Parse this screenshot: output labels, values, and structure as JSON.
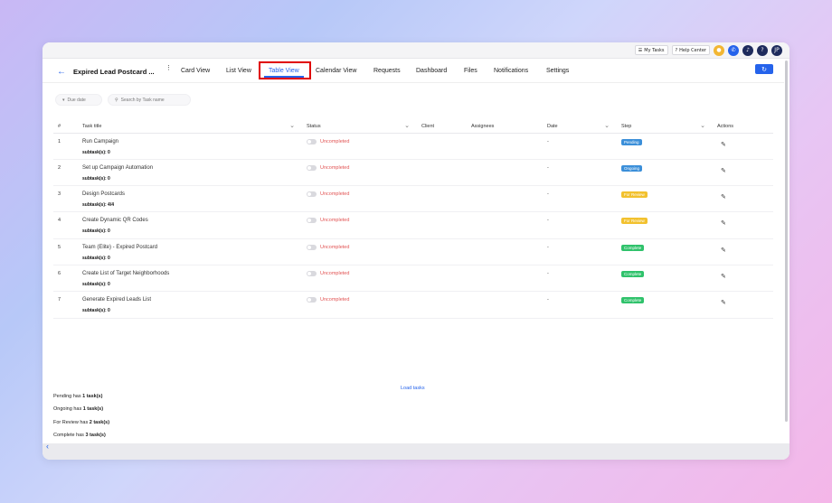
{
  "topbar": {
    "my_tasks": "My Tasks",
    "help_center": "Help Center",
    "avatar_initials": "JP"
  },
  "header": {
    "project_title": "Expired Lead Postcard ...",
    "tabs": [
      {
        "label": "Card View"
      },
      {
        "label": "List View"
      },
      {
        "label": "Table View"
      },
      {
        "label": "Calendar View"
      },
      {
        "label": "Requests"
      },
      {
        "label": "Dashboard"
      },
      {
        "label": "Files"
      },
      {
        "label": "Notifications"
      },
      {
        "label": "Settings"
      }
    ],
    "active_tab": "Table View"
  },
  "filters": {
    "due_date": "Due date",
    "search_placeholder": "Search by Task name"
  },
  "table": {
    "columns": [
      "#",
      "Task title",
      "Status",
      "Client",
      "Assignees",
      "Date",
      "Step",
      "Actions"
    ],
    "rows": [
      {
        "num": "1",
        "title": "Run Campaign",
        "subtask": "subtask(s): 0",
        "status": "Uncompleted",
        "date": "-",
        "step": "Pending",
        "step_color": "#3b8fd9"
      },
      {
        "num": "2",
        "title": "Set up Campaign Automation",
        "subtask": "subtask(s): 0",
        "status": "Uncompleted",
        "date": "-",
        "step": "Ongoing",
        "step_color": "#3b8fd9"
      },
      {
        "num": "3",
        "title": "Design Postcards",
        "subtask": "subtask(s): 4/4",
        "status": "Uncompleted",
        "date": "-",
        "step": "For Review",
        "step_color": "#f2c12e"
      },
      {
        "num": "4",
        "title": "Create Dynamic QR Codes",
        "subtask": "subtask(s): 0",
        "status": "Uncompleted",
        "date": "-",
        "step": "For Review",
        "step_color": "#f2c12e"
      },
      {
        "num": "5",
        "title": "Team (Elite) - Expired Postcard",
        "subtask": "subtask(s): 0",
        "status": "Uncompleted",
        "date": "-",
        "step": "Complete",
        "step_color": "#2fc26b"
      },
      {
        "num": "6",
        "title": "Create List of Target Neighborhoods",
        "subtask": "subtask(s): 0",
        "status": "Uncompleted",
        "date": "-",
        "step": "Complete",
        "step_color": "#2fc26b"
      },
      {
        "num": "7",
        "title": "Generate Expired Leads List",
        "subtask": "subtask(s): 0",
        "status": "Uncompleted",
        "date": "-",
        "step": "Complete",
        "step_color": "#2fc26b"
      }
    ]
  },
  "load_tasks": "Load tasks",
  "summary": [
    {
      "prefix": "Pending has ",
      "count": "1 task(s)"
    },
    {
      "prefix": "Ongoing has ",
      "count": "1 task(s)"
    },
    {
      "prefix": "For Review has ",
      "count": "2 task(s)"
    },
    {
      "prefix": "Complete has ",
      "count": "3 task(s)"
    }
  ],
  "colors": {
    "accent": "#2563eb",
    "highlight": "#e00000",
    "uncompleted": "#e25555"
  }
}
